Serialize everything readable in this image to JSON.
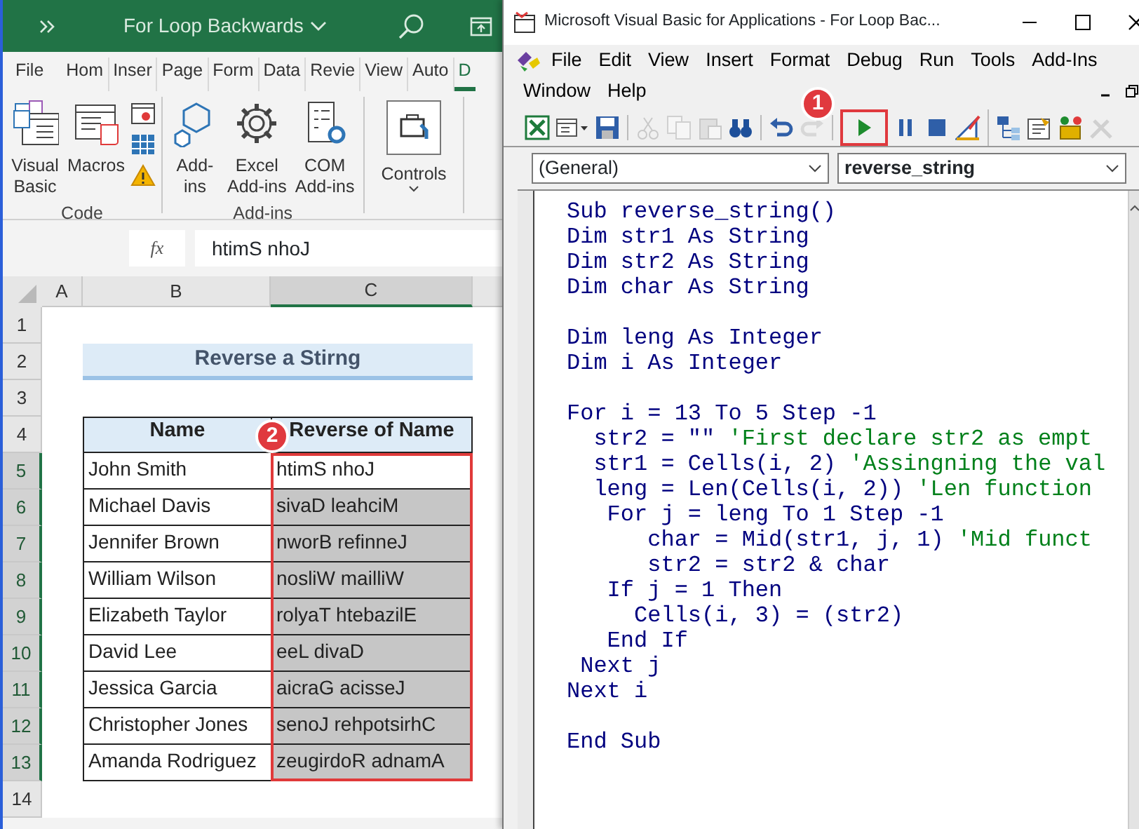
{
  "excel": {
    "title": "For Loop Backwards",
    "tabs": [
      {
        "label": "File",
        "selected": false
      },
      {
        "label": "Hom",
        "selected": false
      },
      {
        "label": "Inser",
        "selected": false
      },
      {
        "label": "Page",
        "selected": false
      },
      {
        "label": "Form",
        "selected": false
      },
      {
        "label": "Data",
        "selected": false
      },
      {
        "label": "Revie",
        "selected": false
      },
      {
        "label": "View",
        "selected": false
      },
      {
        "label": "Auto",
        "selected": false
      },
      {
        "label": "D",
        "selected": true
      }
    ],
    "ribbon_groups": [
      {
        "label": "Code",
        "buttons": [
          {
            "kind": "vb",
            "lines": [
              "Visual",
              "Basic"
            ]
          },
          {
            "kind": "macros",
            "lines": [
              "Macros"
            ]
          },
          {
            "kind": "smalls"
          }
        ]
      },
      {
        "label": "Add-ins",
        "buttons": [
          {
            "kind": "addins",
            "lines": [
              "Add-",
              "ins"
            ]
          },
          {
            "kind": "excel-addins",
            "lines": [
              "Excel",
              "Add-ins"
            ]
          },
          {
            "kind": "com-addins",
            "lines": [
              "COM",
              "Add-ins"
            ]
          }
        ]
      },
      {
        "buttons": [
          {
            "kind": "controls",
            "lines": [
              "Controls"
            ]
          }
        ]
      }
    ],
    "formula_bar": {
      "function_label": "fx",
      "value": "htimS nhoJ"
    },
    "columns": [
      {
        "label": "A",
        "selected": false
      },
      {
        "label": "B",
        "selected": false
      },
      {
        "label": "C",
        "selected": true
      }
    ],
    "row_headers": [
      {
        "label": "1",
        "selected": false
      },
      {
        "label": "2",
        "selected": false
      },
      {
        "label": "3",
        "selected": false
      },
      {
        "label": "4",
        "selected": false
      },
      {
        "label": "5",
        "selected": true
      },
      {
        "label": "6",
        "selected": true
      },
      {
        "label": "7",
        "selected": true
      },
      {
        "label": "8",
        "selected": true
      },
      {
        "label": "9",
        "selected": true
      },
      {
        "label": "10",
        "selected": true
      },
      {
        "label": "11",
        "selected": true
      },
      {
        "label": "12",
        "selected": true
      },
      {
        "label": "13",
        "selected": true
      },
      {
        "label": "14",
        "selected": false
      }
    ],
    "sheet_title": "Reverse a Stirng",
    "table_header": [
      "Name",
      "Reverse of Name"
    ],
    "table_rows": [
      {
        "name": "John Smith",
        "reverse": "htimS nhoJ",
        "selected": true,
        "active": true
      },
      {
        "name": "Michael Davis",
        "reverse": "sivaD leahciM",
        "selected": true,
        "active": false
      },
      {
        "name": "Jennifer Brown",
        "reverse": "nworB refinneJ",
        "selected": true,
        "active": false
      },
      {
        "name": "William Wilson",
        "reverse": "nosliW mailliW",
        "selected": true,
        "active": false
      },
      {
        "name": "Elizabeth Taylor",
        "reverse": "rolyaT htebazilE",
        "selected": true,
        "active": false
      },
      {
        "name": "David Lee",
        "reverse": "eeL divaD",
        "selected": true,
        "active": false
      },
      {
        "name": "Jessica Garcia",
        "reverse": "aicraG acisseJ",
        "selected": true,
        "active": false
      },
      {
        "name": "Christopher Jones",
        "reverse": "senoJ rehpotsirhC",
        "selected": true,
        "active": false
      },
      {
        "name": "Amanda Rodriguez",
        "reverse": "zeugirdoR adnamA",
        "selected": true,
        "active": false
      }
    ],
    "callout": "2"
  },
  "vba": {
    "title": "Microsoft Visual Basic for Applications - For Loop Bac...",
    "menu_rows": [
      [
        "File",
        "Edit",
        "View",
        "Insert",
        "Format",
        "Debug",
        "Run",
        "Tools",
        "Add-Ins"
      ],
      [
        "Window",
        "Help"
      ]
    ],
    "toolbar_groups": [
      [
        {
          "kind": "excel",
          "disabled": false
        },
        {
          "kind": "object",
          "disabled": false
        },
        {
          "kind": "save",
          "disabled": false
        }
      ],
      [
        {
          "kind": "cut",
          "disabled": true
        },
        {
          "kind": "copy",
          "disabled": true
        },
        {
          "kind": "paste",
          "disabled": true
        },
        {
          "kind": "find",
          "disabled": false
        }
      ],
      [
        {
          "kind": "undo",
          "disabled": false
        },
        {
          "kind": "redo",
          "disabled": true
        }
      ],
      [
        {
          "kind": "run",
          "disabled": false,
          "highlighted": true
        },
        {
          "kind": "pause",
          "disabled": false
        },
        {
          "kind": "stop",
          "disabled": false
        },
        {
          "kind": "design",
          "disabled": false
        }
      ],
      [
        {
          "kind": "explorer",
          "disabled": false
        },
        {
          "kind": "properties",
          "disabled": false
        },
        {
          "kind": "browser",
          "disabled": false
        },
        {
          "kind": "toolbox",
          "disabled": true
        }
      ]
    ],
    "dropdowns": [
      "(General)",
      "reverse_string"
    ],
    "callout": "1",
    "code_lines": [
      {
        "kind": "code",
        "code": "Sub reverse_string()"
      },
      {
        "kind": "code",
        "code": "Dim str1 As String"
      },
      {
        "kind": "code",
        "code": "Dim str2 As String"
      },
      {
        "kind": "code",
        "code": "Dim char As String"
      },
      {
        "kind": "blank"
      },
      {
        "kind": "code",
        "code": "Dim leng As Integer"
      },
      {
        "kind": "code",
        "code": "Dim i As Integer"
      },
      {
        "kind": "blank"
      },
      {
        "kind": "code",
        "code": "For i = 13 To 5 Step -1"
      },
      {
        "kind": "code",
        "code": "  str2 = \"\" ",
        "comment": "'First declare str2 as empt"
      },
      {
        "kind": "code",
        "code": "  str1 = Cells(i, 2) ",
        "comment": "'Assingning the val"
      },
      {
        "kind": "code",
        "code": "  leng = Len(Cells(i, 2)) ",
        "comment": "'Len function"
      },
      {
        "kind": "code",
        "code": "   For j = leng To 1 Step -1"
      },
      {
        "kind": "code",
        "code": "      char = Mid(str1, j, 1) ",
        "comment": "'Mid funct"
      },
      {
        "kind": "code",
        "code": "      str2 = str2 & char"
      },
      {
        "kind": "code",
        "code": "   If j = 1 Then"
      },
      {
        "kind": "code",
        "code": "     Cells(i, 3) = (str2)"
      },
      {
        "kind": "code",
        "code": "   End If"
      },
      {
        "kind": "code",
        "code": " Next j"
      },
      {
        "kind": "code",
        "code": "Next i"
      },
      {
        "kind": "blank"
      },
      {
        "kind": "code",
        "code": "End Sub"
      }
    ]
  }
}
